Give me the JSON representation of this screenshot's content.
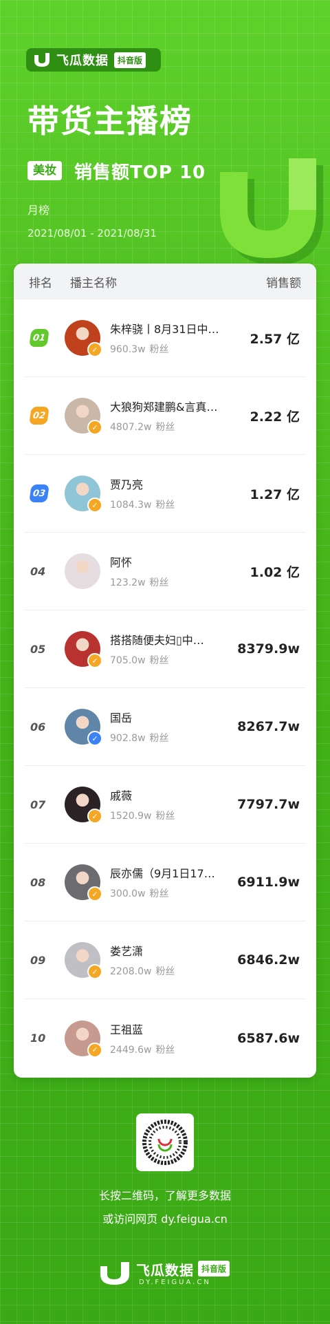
{
  "header": {
    "brand_name": "飞瓜数据",
    "brand_badge": "抖音版",
    "title": "带货主播榜",
    "category": "美妆",
    "subtitle": "销售额TOP 10",
    "period_label": "月榜",
    "date_range": "2021/08/01 - 2021/08/31"
  },
  "table": {
    "col_rank": "排名",
    "col_name": "播主名称",
    "col_sales": "销售额",
    "fans_label": "粉丝",
    "rows": [
      {
        "rank": "01",
        "name": "朱梓骁丨8月31日中…",
        "fans": "960.3w",
        "sales": "2.57 亿",
        "avatar_color": "#c0421d",
        "verify_color": "#f5a623"
      },
      {
        "rank": "02",
        "name": "大狼狗郑建鹏&言真…",
        "fans": "4807.2w",
        "sales": "2.22 亿",
        "avatar_color": "#c9b7a8",
        "verify_color": "#f5a623"
      },
      {
        "rank": "03",
        "name": "贾乃亮",
        "fans": "1084.3w",
        "sales": "1.27 亿",
        "avatar_color": "#8ec6d8",
        "verify_color": "#f5a623"
      },
      {
        "rank": "04",
        "name": "阿怀",
        "fans": "123.2w",
        "sales": "1.02 亿",
        "avatar_color": "#e6dde0",
        "verify_color": ""
      },
      {
        "rank": "05",
        "name": "搭搭随便夫妇▯中…",
        "fans": "705.0w",
        "sales": "8379.9w",
        "avatar_color": "#b8332f",
        "verify_color": "#f5a623"
      },
      {
        "rank": "06",
        "name": "国岳",
        "fans": "902.8w",
        "sales": "8267.7w",
        "avatar_color": "#5f86a8",
        "verify_color": "#3b82f6"
      },
      {
        "rank": "07",
        "name": "戚薇",
        "fans": "1520.9w",
        "sales": "7797.7w",
        "avatar_color": "#2a2224",
        "verify_color": "#f5a623"
      },
      {
        "rank": "08",
        "name": "辰亦儒（9月1日17…",
        "fans": "300.0w",
        "sales": "6911.9w",
        "avatar_color": "#6b6b70",
        "verify_color": "#f5a623"
      },
      {
        "rank": "09",
        "name": "娄艺潇",
        "fans": "2208.0w",
        "sales": "6846.2w",
        "avatar_color": "#bfbfc4",
        "verify_color": "#f5a623"
      },
      {
        "rank": "10",
        "name": "王祖蓝",
        "fans": "2449.6w",
        "sales": "6587.6w",
        "avatar_color": "#c79a8f",
        "verify_color": "#f5a623"
      }
    ],
    "medal_colors": [
      "#62c92a",
      "#f5a623",
      "#3b82f6"
    ]
  },
  "footer": {
    "cta_line1": "长按二维码，了解更多数据",
    "cta_line2": "或访问网页 dy.feigua.cn",
    "brand_name": "飞瓜数据",
    "brand_badge": "抖音版",
    "domain": "DY.FEIGUA.CN"
  },
  "colors": {
    "brand_green": "#45b41a",
    "dark_green": "#2f8f12"
  }
}
